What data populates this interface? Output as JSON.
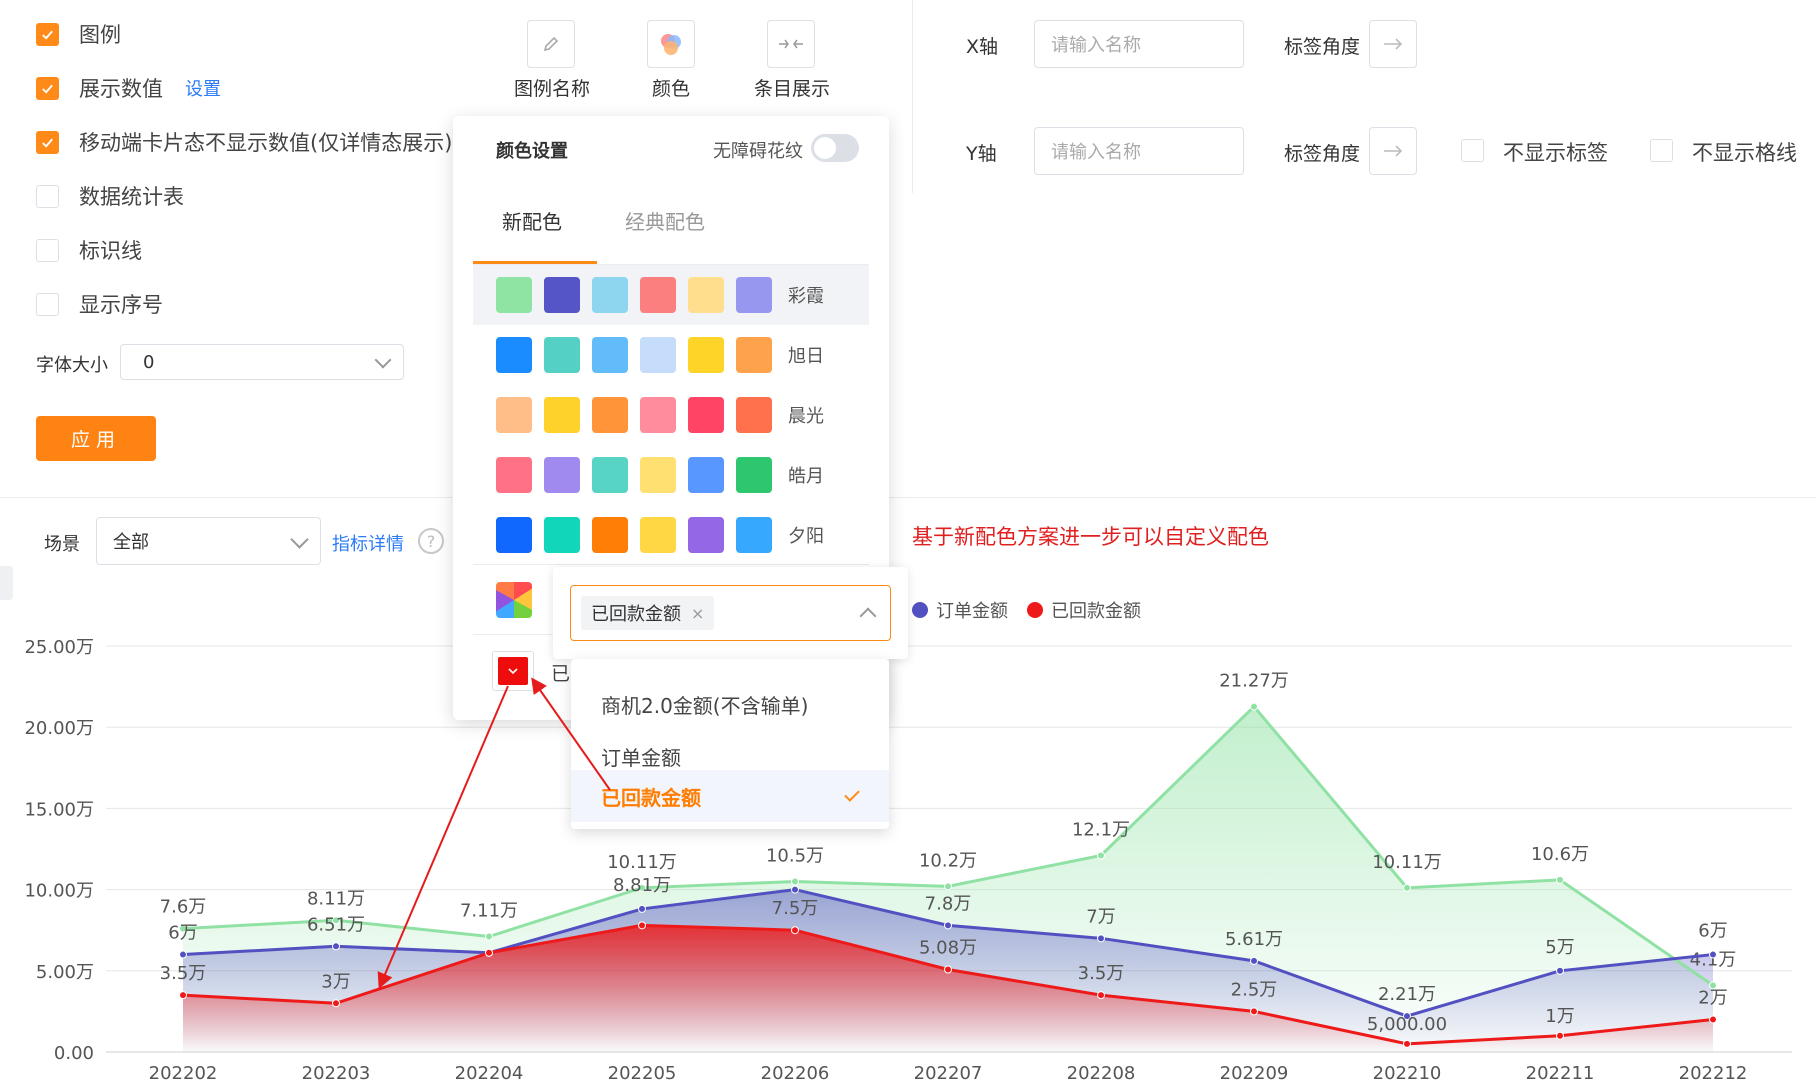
{
  "options": {
    "legend": {
      "label": "图例",
      "checked": true
    },
    "show_values": {
      "label": "展示数值",
      "checked": true,
      "link": "设置"
    },
    "mobile_hide": {
      "label": "移动端卡片态不显示数值(仅详情态展示)",
      "checked": true
    },
    "stats_table": {
      "label": "数据统计表",
      "checked": false
    },
    "mark_line": {
      "label": "标识线",
      "checked": false
    },
    "show_index": {
      "label": "显示序号",
      "checked": false
    },
    "font_size": {
      "label": "字体大小",
      "value": "0"
    },
    "apply_label": "应用"
  },
  "toolbar": {
    "legend_name": "图例名称",
    "color": "颜色",
    "bar_display": "条目展示"
  },
  "axes": {
    "x_label": "X轴",
    "y_label": "Y轴",
    "x_placeholder": "请输入名称",
    "y_placeholder": "请输入名称",
    "angle_label": "标签角度",
    "hide_tick_labels": "不显示标签",
    "hide_grid": "不显示格线"
  },
  "filter": {
    "scene_label": "场景",
    "scene_value": "全部",
    "metric_link": "指标详情",
    "help": "?"
  },
  "color_popup": {
    "title": "颜色设置",
    "accessible_label": "无障碍花纹",
    "tabs": [
      "新配色",
      "经典配色"
    ],
    "schemes": [
      {
        "name": "彩霞",
        "colors": [
          "#8fe3a3",
          "#5655c7",
          "#8ed5f0",
          "#fc7f7f",
          "#ffdf8e",
          "#9797ef"
        ]
      },
      {
        "name": "旭日",
        "colors": [
          "#1a8cff",
          "#54d1c4",
          "#63bcfa",
          "#c6dcfb",
          "#ffd429",
          "#ffa24c"
        ]
      },
      {
        "name": "晨光",
        "colors": [
          "#ffbe87",
          "#ffd12b",
          "#ff9439",
          "#ff8c9d",
          "#ff4466",
          "#ff704c"
        ]
      },
      {
        "name": "皓月",
        "colors": [
          "#ff7185",
          "#a08af0",
          "#58d4c5",
          "#ffe071",
          "#5797ff",
          "#2ec66f"
        ]
      },
      {
        "name": "夕阳",
        "colors": [
          "#1068ff",
          "#11d6b9",
          "#ff7e06",
          "#ffd744",
          "#9467e6",
          "#36a9ff"
        ]
      }
    ],
    "custom_series_label": "已"
  },
  "series_select": {
    "selected_tag": "已回款金额",
    "tag_close": "×",
    "options": [
      "商机2.0金额(不含输单)",
      "订单金额",
      "已回款金额"
    ],
    "selected_index": 2
  },
  "annotation": "基于新配色方案进一步可以自定义配色",
  "chart_data": {
    "type": "line",
    "area": true,
    "categories": [
      "202202",
      "202203",
      "202204",
      "202205",
      "202206",
      "202207",
      "202208",
      "202209",
      "202210",
      "202211",
      "202212"
    ],
    "ylim": [
      0,
      25
    ],
    "y_ticks": [
      "0.00",
      "5.00万",
      "10.00万",
      "15.00万",
      "20.00万",
      "25.00万"
    ],
    "grid": true,
    "legend_position": "top-right",
    "series": [
      {
        "color": "#90e2a4",
        "values": [
          7.6,
          8.11,
          7.11,
          10.11,
          10.5,
          10.2,
          12.1,
          21.27,
          10.11,
          10.6,
          4.1
        ],
        "labels": [
          "7.6万",
          "8.11万",
          "7.11万",
          "10.11万",
          "10.5万",
          "10.2万",
          "12.1万",
          "21.27万",
          "10.11万",
          "10.6万",
          "4.1万"
        ]
      },
      {
        "name": "订单金额",
        "color": "#5351c1",
        "values": [
          6,
          6.51,
          6.11,
          8.81,
          10.0,
          7.8,
          7.0,
          5.61,
          2.21,
          5.0,
          6.0
        ],
        "labels": [
          "6万",
          "6.51万",
          "",
          "8.81万",
          "",
          "7.8万",
          "7万",
          "5.61万",
          "2.21万",
          "5万",
          "6万"
        ]
      },
      {
        "name": "已回款金额",
        "color": "#ee1a1a",
        "values": [
          3.5,
          3.0,
          6.11,
          7.8,
          7.5,
          5.08,
          3.5,
          2.5,
          0.5,
          1.0,
          2.0
        ],
        "labels": [
          "3.5万",
          "3万",
          "",
          "",
          "7.5万",
          "5.08万",
          "3.5万",
          "2.5万",
          "5,000.00",
          "1万",
          "2万"
        ]
      }
    ]
  }
}
